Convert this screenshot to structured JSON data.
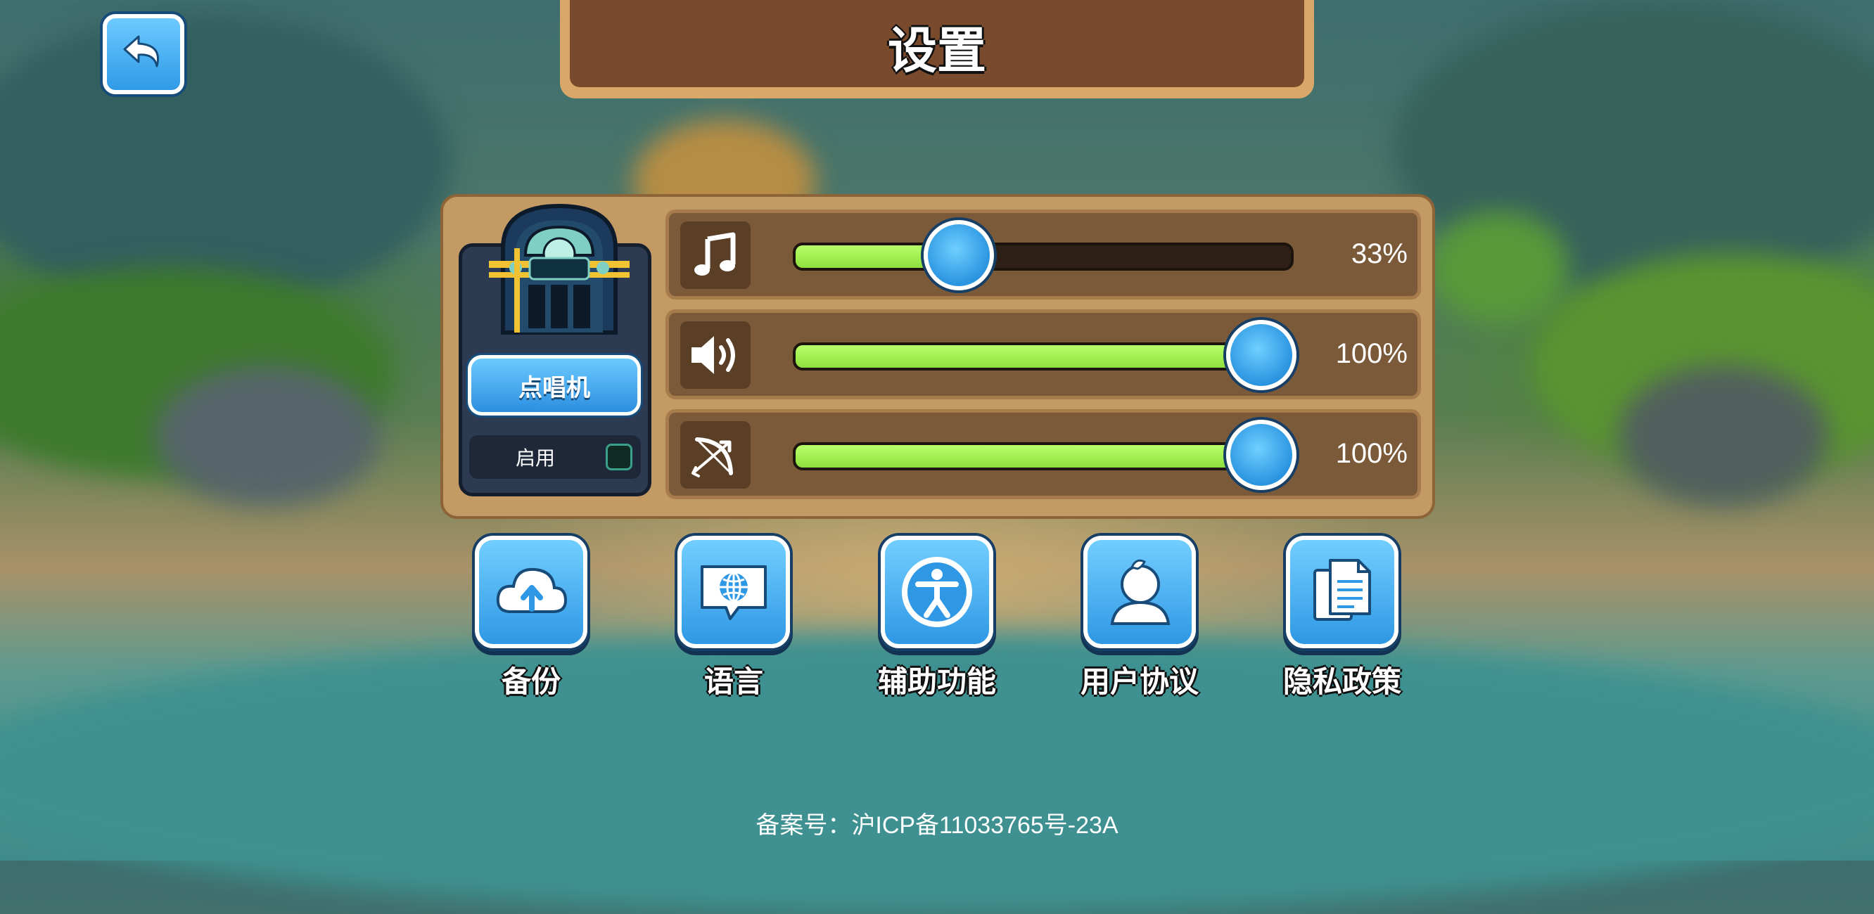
{
  "header": {
    "title": "设置"
  },
  "back_button": {
    "icon": "back-arrow-icon"
  },
  "jukebox": {
    "button_label": "点唱机",
    "toggle_label": "启用",
    "toggle_checked": false
  },
  "sliders": [
    {
      "name": "music",
      "icon": "music-note-icon",
      "value": 33,
      "display": "33%"
    },
    {
      "name": "sound",
      "icon": "speaker-icon",
      "value": 100,
      "display": "100%"
    },
    {
      "name": "effects",
      "icon": "bow-icon",
      "value": 100,
      "display": "100%"
    }
  ],
  "functions": [
    {
      "label": "备份",
      "icon": "cloud-upload-icon"
    },
    {
      "label": "语言",
      "icon": "globe-chat-icon"
    },
    {
      "label": "辅助功能",
      "icon": "accessibility-icon"
    },
    {
      "label": "用户协议",
      "icon": "user-agreement-icon"
    },
    {
      "label": "隐私政策",
      "icon": "privacy-document-icon"
    }
  ],
  "footer": {
    "icp": "备案号：沪ICP备11033765号-23A"
  },
  "colors": {
    "accent": "#2f98e4",
    "fill": "#9be84f",
    "panel": "#c49a64",
    "title_plate": "#7a4a2c"
  }
}
